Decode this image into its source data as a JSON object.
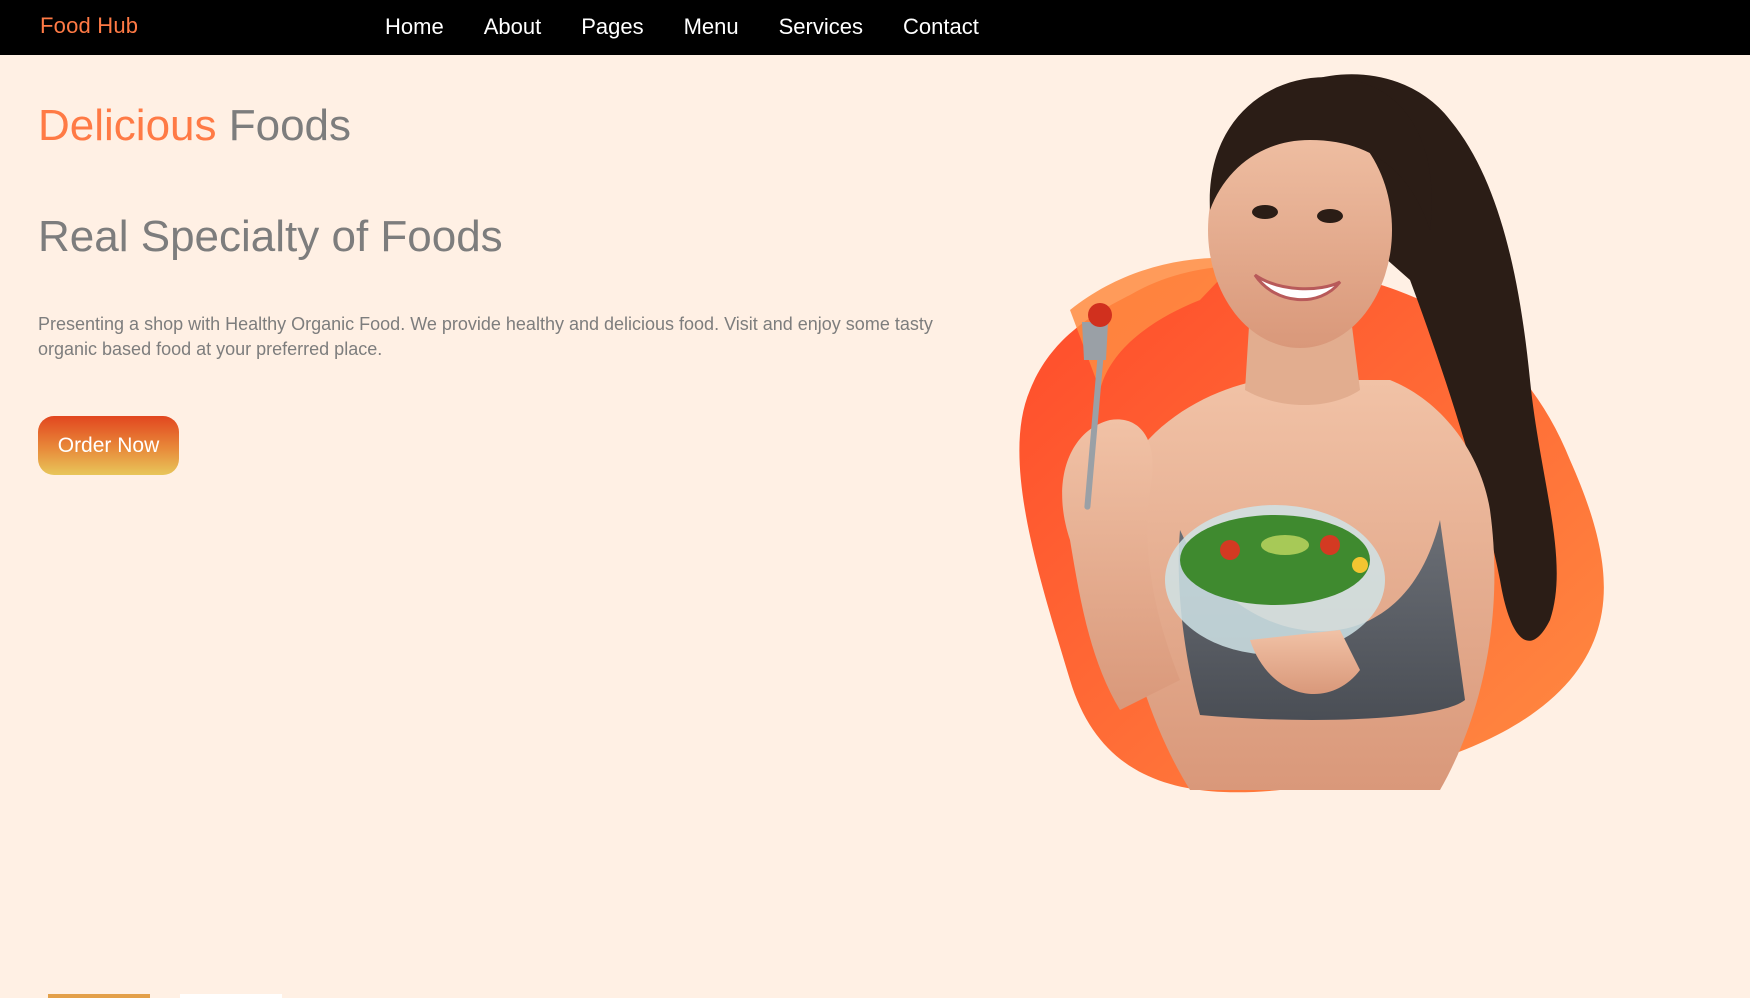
{
  "brand": {
    "name": "Food Hub"
  },
  "nav": {
    "items": [
      {
        "label": "Home"
      },
      {
        "label": "About"
      },
      {
        "label": "Pages"
      },
      {
        "label": "Menu"
      },
      {
        "label": "Services"
      },
      {
        "label": "Contact"
      }
    ]
  },
  "hero": {
    "title_accent": "Delicious",
    "title_rest": " Foods",
    "subtitle": "Real Specialty of Foods",
    "description": "Presenting a shop with Healthy Organic Food. We provide healthy and delicious food. Visit and enjoy some tasty organic based food at your preferred place.",
    "cta_label": "Order Now",
    "image_alt": "Smiling woman holding a glass bowl of salad and a fork with a cherry tomato"
  },
  "colors": {
    "nav_background": "#000000",
    "page_background": "#fff0e4",
    "accent": "#ff7a45",
    "text_gray": "#7d7d7d",
    "blob_inner": "#ff4a2a",
    "blob_outer": "#ff8c42"
  }
}
